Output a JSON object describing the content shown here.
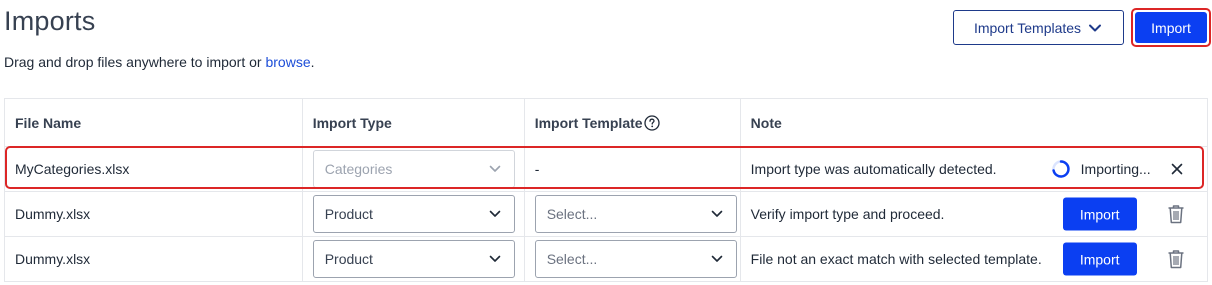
{
  "header": {
    "title": "Imports",
    "subtitle_text": "Drag and drop files anywhere to import or",
    "subtitle_link": "browse",
    "subtitle_end": ".",
    "templates_button": "Import Templates",
    "import_button": "Import"
  },
  "table": {
    "columns": [
      "File Name",
      "Import Type",
      "Import Template",
      "Note"
    ],
    "rows": [
      {
        "file": "MyCategories.xlsx",
        "type": "Categories",
        "template": "-",
        "note": "Import type was automatically detected.",
        "status": "Importing..."
      },
      {
        "file": "Dummy.xlsx",
        "type": "Product",
        "template": "Select...",
        "note": "Verify import type and proceed.",
        "action": "Import"
      },
      {
        "file": "Dummy.xlsx",
        "type": "Product",
        "template": "Select...",
        "note": "File not an exact match with selected template.",
        "action": "Import"
      }
    ]
  },
  "icons": {
    "templates_dropdown": "chevron-down-icon",
    "help": "question-circle-icon",
    "select": "chevron-down-icon",
    "loading": "spinner-icon",
    "cancel": "close-icon",
    "delete": "trash-icon"
  },
  "colors": {
    "primary": "#0b3ff2",
    "outline": "#1e3a8a",
    "highlight": "#dc2626",
    "link": "#1d4ed8"
  }
}
